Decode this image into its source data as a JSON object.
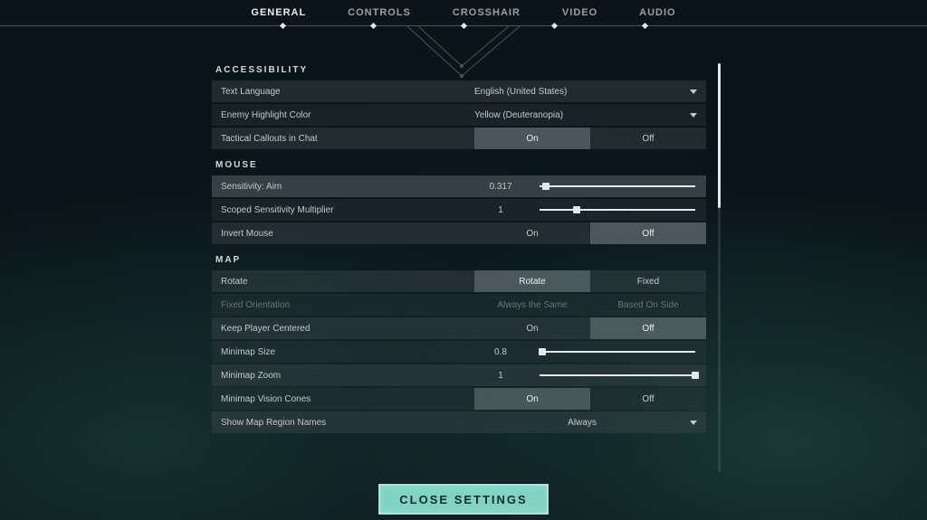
{
  "nav": {
    "tabs": [
      "GENERAL",
      "CONTROLS",
      "CROSSHAIR",
      "VIDEO",
      "AUDIO"
    ],
    "active_index": 0
  },
  "sections": {
    "accessibility": {
      "title": "ACCESSIBILITY",
      "text_language": {
        "label": "Text Language",
        "value": "English (United States)"
      },
      "enemy_highlight": {
        "label": "Enemy Highlight Color",
        "value": "Yellow (Deuteranopia)"
      },
      "tactical_callouts": {
        "label": "Tactical Callouts in Chat",
        "options": [
          "On",
          "Off"
        ],
        "selected": 0
      }
    },
    "mouse": {
      "title": "MOUSE",
      "sensitivity": {
        "label": "Sensitivity: Aim",
        "value": "0.317",
        "pct": 4
      },
      "scoped_mult": {
        "label": "Scoped Sensitivity Multiplier",
        "value": "1",
        "pct": 24
      },
      "invert": {
        "label": "Invert Mouse",
        "options": [
          "On",
          "Off"
        ],
        "selected": 1
      }
    },
    "map": {
      "title": "MAP",
      "rotate": {
        "label": "Rotate",
        "options": [
          "Rotate",
          "Fixed"
        ],
        "selected": 0
      },
      "fixed_orientation": {
        "label": "Fixed Orientation",
        "options": [
          "Always the Same",
          "Based On Side"
        ],
        "selected": -1
      },
      "keep_centered": {
        "label": "Keep Player Centered",
        "options": [
          "On",
          "Off"
        ],
        "selected": 1
      },
      "minimap_size": {
        "label": "Minimap Size",
        "value": "0.8",
        "pct": 2
      },
      "minimap_zoom": {
        "label": "Minimap Zoom",
        "value": "1",
        "pct": 100
      },
      "vision_cones": {
        "label": "Minimap Vision Cones",
        "options": [
          "On",
          "Off"
        ],
        "selected": 0
      },
      "region_names": {
        "label": "Show Map Region Names",
        "value": "Always"
      }
    }
  },
  "close_label": "CLOSE SETTINGS"
}
